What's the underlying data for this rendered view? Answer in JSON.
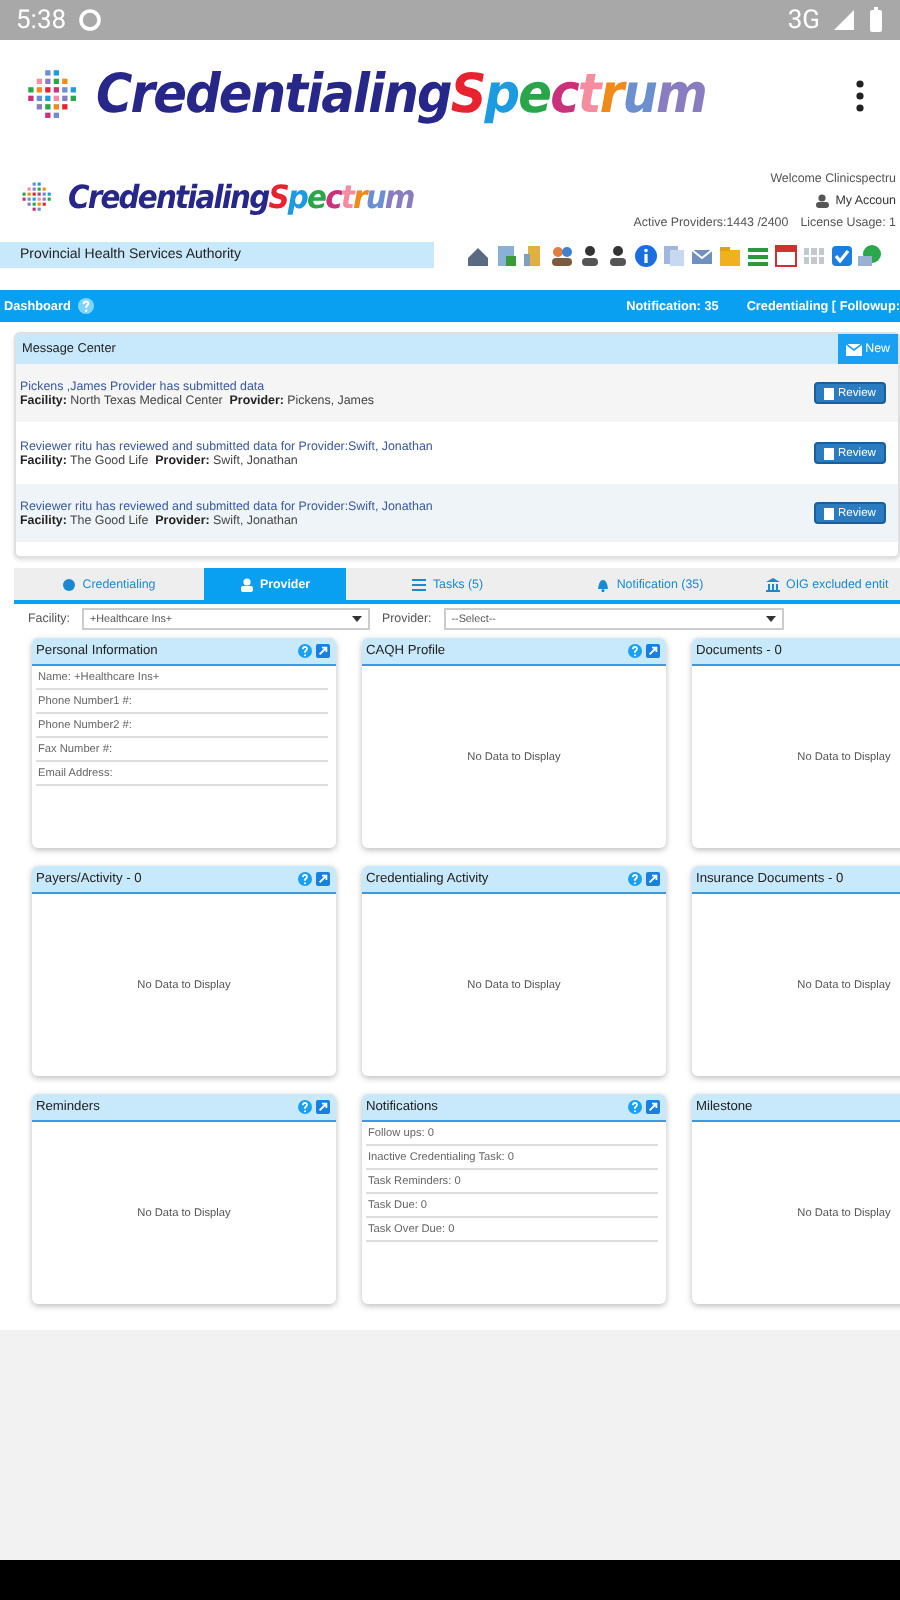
{
  "status_bar": {
    "time": "5:38",
    "network": "3G"
  },
  "app_bar": {
    "logo": {
      "first": "Credentialing",
      "second": "Spectrum"
    }
  },
  "site_header": {
    "logo": {
      "first": "Credentialing",
      "second": "Spectrum"
    },
    "welcome": "Welcome Clinicspectru",
    "account_link": "My Accoun",
    "active_providers": "Active Providers:1443 /2400",
    "license_usage": "License Usage: 1",
    "organization": "Provincial Health Services Authority"
  },
  "dashboard_bar": {
    "title": "Dashboard",
    "notification": "Notification: 35",
    "credentialing": "Credentialing [ Followup:"
  },
  "message_center": {
    "title": "Message Center",
    "new_button": "New",
    "messages": [
      {
        "text": "Pickens ,James Provider has submitted data",
        "detail": "**Facility:** North Texas Medical Center  **Provider:** Pickens, James",
        "action": "Review"
      },
      {
        "text": "Reviewer ritu has reviewed and submitted data for Provider:Swift, Jonathan",
        "detail": "**Facility:** The Good Life  **Provider:** Swift, Jonathan",
        "action": "Review"
      },
      {
        "text": "Reviewer ritu has reviewed and submitted data for Provider:Swift, Jonathan",
        "detail": "**Facility:** The Good Life  **Provider:** Swift, Jonathan",
        "action": "Review"
      }
    ]
  },
  "tabs": [
    {
      "label": "Credentialing",
      "kind": "circle",
      "selected": false
    },
    {
      "label": "Provider",
      "kind": "person",
      "selected": true
    },
    {
      "label": "Tasks (5)",
      "kind": "list",
      "selected": false
    },
    {
      "label": "Notification (35)",
      "kind": "bell",
      "selected": false
    },
    {
      "label": "OIG excluded entit",
      "kind": "bank",
      "selected": false
    }
  ],
  "filters": [
    {
      "label": "Facility:",
      "value": "+Healthcare Ins+"
    },
    {
      "label": "Provider:",
      "value": "--Select--"
    }
  ],
  "widgets": [
    {
      "title": "Personal Information",
      "tools": true,
      "kind": "list",
      "items": [
        "Name: +Healthcare Ins+",
        "Phone Number1 #:",
        "Phone Number2 #:",
        "Fax Number #:",
        "Email Address:"
      ]
    },
    {
      "title": "CAQH Profile",
      "tools": true,
      "kind": "empty",
      "empty_text": "No Data to Display"
    },
    {
      "title": "Documents - 0",
      "tools": false,
      "kind": "empty",
      "empty_text": "No Data to Display"
    },
    {
      "title": "Payers/Activity - 0",
      "tools": true,
      "kind": "empty",
      "empty_text": "No Data to Display"
    },
    {
      "title": "Credentialing Activity",
      "tools": true,
      "kind": "empty",
      "empty_text": "No Data to Display"
    },
    {
      "title": "Insurance Documents - 0",
      "tools": false,
      "kind": "empty",
      "empty_text": "No Data to Display"
    },
    {
      "title": "Reminders",
      "tools": true,
      "kind": "empty",
      "empty_text": "No Data to Display"
    },
    {
      "title": "Notifications",
      "tools": true,
      "kind": "list",
      "items": [
        "Follow ups: 0",
        "Inactive Credentialing Task: 0",
        "Task Reminders: 0",
        "Task Due: 0",
        "Task Over Due: 0"
      ]
    },
    {
      "title": "Milestone",
      "tools": false,
      "kind": "empty",
      "empty_text": "No Data to Display"
    }
  ]
}
